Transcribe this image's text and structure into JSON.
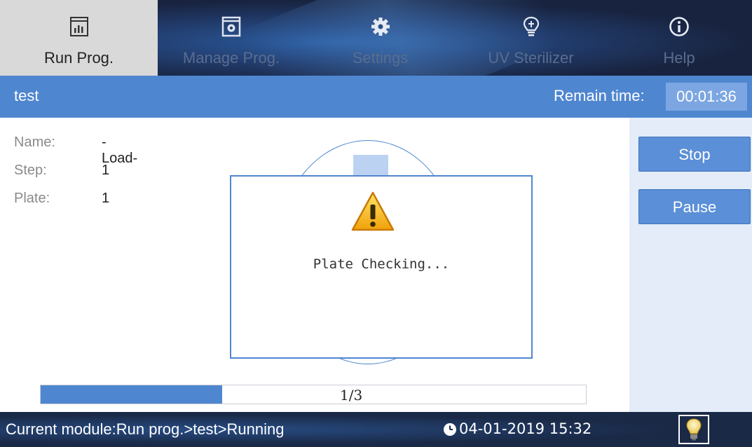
{
  "nav": {
    "tabs": [
      {
        "label": "Run Prog.",
        "icon": "chart-icon",
        "active": true
      },
      {
        "label": "Manage Prog.",
        "icon": "gear-box-icon",
        "active": false
      },
      {
        "label": "Settings",
        "icon": "gear-icon",
        "active": false
      },
      {
        "label": "UV Sterilizer",
        "icon": "bulb-shield-icon",
        "active": false
      },
      {
        "label": "Help",
        "icon": "info-icon",
        "active": false
      }
    ]
  },
  "header": {
    "title": "test",
    "remain_label": "Remain time:",
    "remain_value": "00:01:36"
  },
  "info": {
    "name_label": "Name:",
    "name_value": "-Load-",
    "step_label": "Step:",
    "step_value": "1",
    "plate_label": "Plate:",
    "plate_value": "1"
  },
  "actions": {
    "stop_label": "Stop",
    "pause_label": "Pause"
  },
  "dialog": {
    "icon": "warning-icon",
    "message": "Plate Checking..."
  },
  "progress": {
    "text": "1/3",
    "fraction": 0.333
  },
  "status": {
    "module_text": "Current module:Run prog.>test>Running",
    "datetime": "04-01-2019 15:32",
    "clock_icon": "clock-icon",
    "light_icon": "lightbulb-icon"
  },
  "colors": {
    "accent": "#4f86d0",
    "nav_bg": "#1b2a4a",
    "panel_bg": "#e3ecf8"
  }
}
